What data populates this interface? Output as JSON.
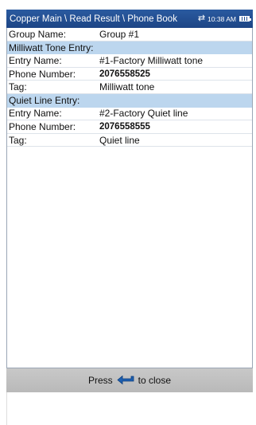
{
  "titlebar": {
    "breadcrumb": "Copper Main \\ Read Result \\ Phone Book",
    "time": "10:38 AM",
    "sync_icon": "sync-arrows-icon",
    "battery_icon": "battery-icon"
  },
  "group": {
    "label": "Group Name:",
    "value": "Group #1"
  },
  "milliwatt": {
    "section_title": "Milliwatt Tone Entry:",
    "entry_label": "Entry Name:",
    "entry_value": "#1-Factory Milliwatt tone",
    "phone_label": "Phone Number:",
    "phone_value": "2076558525",
    "tag_label": "Tag:",
    "tag_value": "Milliwatt tone"
  },
  "quiet": {
    "section_title": "Quiet Line Entry:",
    "entry_label": "Entry Name:",
    "entry_value": "#2-Factory Quiet line",
    "phone_label": "Phone Number:",
    "phone_value": "2076558555",
    "tag_label": "Tag:",
    "tag_value": "Quiet line"
  },
  "footer": {
    "press_text": "Press",
    "close_text": "to close",
    "icon": "back-arrow-icon"
  },
  "colors": {
    "titlebar": "#1d4585",
    "section": "#bcd6ee",
    "footer": "#c0c0c0"
  }
}
